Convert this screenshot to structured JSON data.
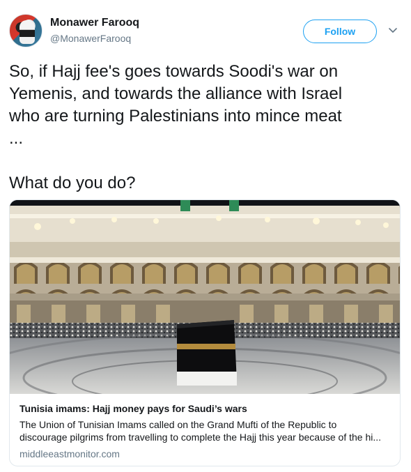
{
  "author": {
    "name": "Monawer Farooq",
    "handle": "@MonawerFarooq",
    "avatar_icon": "profile-avatar"
  },
  "actions": {
    "follow_label": "Follow",
    "menu_icon": "chevron-down-icon"
  },
  "tweet": {
    "text": "So, if Hajj fee's goes towards Soodi's war on\nYemenis, and towards the alliance with Israel\nwho are turning Palestinians into mince meat\n...\n\nWhat do you do?"
  },
  "card": {
    "image_icon": "kaaba-photo",
    "title": "Tunisia imams: Hajj money pays for Saudi’s wars",
    "description_line1": "The Union of Tunisian Imams called on the Grand Mufti of the Republic to",
    "description_line2": "discourage pilgrims from travelling to complete the Hajj this year because of the hi...",
    "domain": "middleeastmonitor.com"
  },
  "colors": {
    "accent": "#1da1f2",
    "text": "#14171a",
    "secondary": "#657786",
    "border": "#e1e8ed"
  }
}
